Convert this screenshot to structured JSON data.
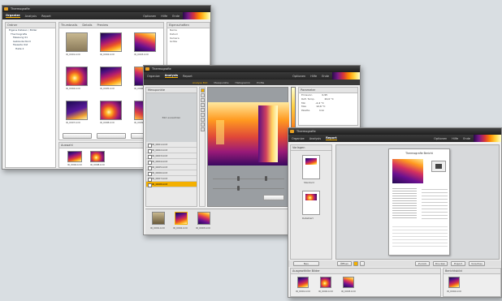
{
  "win1": {
    "title": "Thermografie",
    "menu": [
      "Organize",
      "Analysis",
      "Report"
    ],
    "menu_right": [
      "Optionen",
      "Hilfe",
      "Ende"
    ],
    "folders_header": "Ordner",
    "tree": [
      "Eigene Dateien / Bilder",
      "Thermografie",
      "Messung 01",
      "Gebäude Nord",
      "Fassade Ost",
      "Halle 2"
    ],
    "tabs": [
      "Thumbnails",
      "Details",
      "Preview"
    ],
    "thumbs": [
      "IR_0001.bmt",
      "IR_0002.bmt",
      "IR_0003.bmt",
      "IR_0004.bmt",
      "IR_0005.bmt",
      "IR_0006.bmt",
      "IR_0007.bmt",
      "IR_0008.bmt",
      "IR_0009.bmt"
    ],
    "props_header": "Eigenschaften",
    "props": [
      "Name",
      "Datum",
      "Kamera",
      "Größe"
    ],
    "props2_header": "Bildinformationen",
    "props2": [
      "Emiss.",
      "Temp."
    ],
    "selection_header": "Auswahl",
    "selection": [
      "IR_0004.bmt",
      "IR_0008.bmt"
    ]
  },
  "win2": {
    "title": "Thermografie",
    "menu": [
      "Organize",
      "Analysis",
      "Report"
    ],
    "menu_right": [
      "Optionen",
      "Hilfe",
      "Ende"
    ],
    "subtabs": [
      "Analyse Bild",
      "Messpunkte",
      "Histogramm",
      "Profile"
    ],
    "list_header": "Messpunkte",
    "placeholder": "Bild auswählen",
    "list": [
      "IR_0001.bmt",
      "IR_0002.bmt",
      "IR_0003.bmt",
      "IR_0004.bmt",
      "IR_0005.bmt",
      "IR_0006.bmt",
      "IR_0007.bmt",
      "IR_0008.bmt"
    ],
    "props_header": "Parameter",
    "props": [
      {
        "k": "Emission",
        "v": "0,95"
      },
      {
        "k": "Refl. Temp.",
        "v": "20,0 °C"
      },
      {
        "k": "Min",
        "v": "-2,4 °C"
      },
      {
        "k": "Max",
        "v": "12,6 °C"
      },
      {
        "k": "Palette",
        "v": "Iron"
      }
    ],
    "film": [
      "IR_0001.bmt",
      "IR_0002.bmt",
      "IR_0003.bmt"
    ]
  },
  "win3": {
    "title": "Thermografie",
    "menu": [
      "Organize",
      "Analysis",
      "Report"
    ],
    "menu_right": [
      "Optionen",
      "Hilfe",
      "Ende"
    ],
    "left_header": "Vorlagen",
    "tmpl_caption": [
      "Standard",
      "Detailliert"
    ],
    "report_title": "Thermografie Bericht",
    "buttons": [
      "Neu",
      "Öffnen",
      "Speichern"
    ],
    "bottom_buttons": [
      "Zurück",
      "Drucken",
      "Export",
      "Vorschau"
    ],
    "film_header": "Ausgewählte Bilder",
    "film": [
      "IR_0001.bmt",
      "IR_0002.bmt",
      "IR_0003.bmt"
    ],
    "right_header": "Berichtsbild",
    "right_film": [
      "IR_0004.bmt"
    ]
  }
}
